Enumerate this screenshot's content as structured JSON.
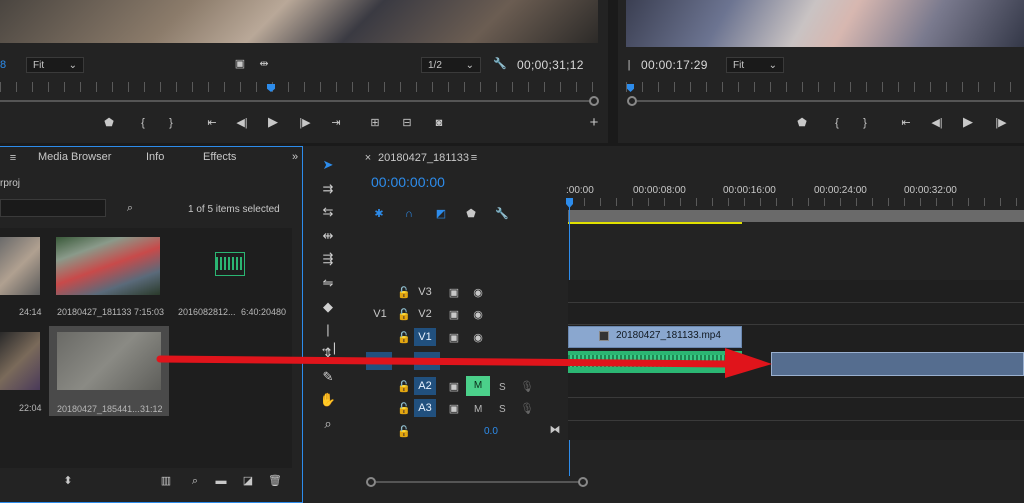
{
  "source_monitor": {
    "fit": "Fit",
    "fit_partial": "8",
    "resolution": "1/2",
    "timecode": "00;00;31;12"
  },
  "program_monitor": {
    "timecode": "00:00:17:29",
    "fit": "Fit"
  },
  "project_panel": {
    "tabs": [
      "Media Browser",
      "Info",
      "Effects"
    ],
    "project_name_partial": "rproj",
    "items_selected": "1 of 5 items selected",
    "items": [
      {
        "name": "",
        "duration": "24:14"
      },
      {
        "name": "20180427_181133",
        "duration": "7:15:03"
      },
      {
        "name": "2016082812...",
        "duration": "6:40:20480"
      },
      {
        "name": "",
        "duration": "22:04"
      },
      {
        "name": "20180427_185441...",
        "duration": "31:12"
      }
    ]
  },
  "timeline": {
    "sequence_name": "20180427_181133",
    "timecode": "00:00:00:00",
    "ruler": [
      ":00:00",
      "00:00:08:00",
      "00:00:16:00",
      "00:00:24:00",
      "00:00:32:00"
    ],
    "tracks": {
      "v3": "V3",
      "v2": "V2",
      "v1": "V1",
      "v1_source": "V1",
      "a2": "A2",
      "a3": "A3",
      "m": "M",
      "s": "S"
    },
    "clip_name": "20180427_181133.mp4",
    "volume": "0.0"
  },
  "colors": {
    "accent_blue": "#2d8ceb",
    "track_blue": "#21507e",
    "audio_green": "#2bb673",
    "mute_green": "#4bd08a",
    "arrow_red": "#e0141b",
    "clip_blue": "#8aa7cf"
  }
}
